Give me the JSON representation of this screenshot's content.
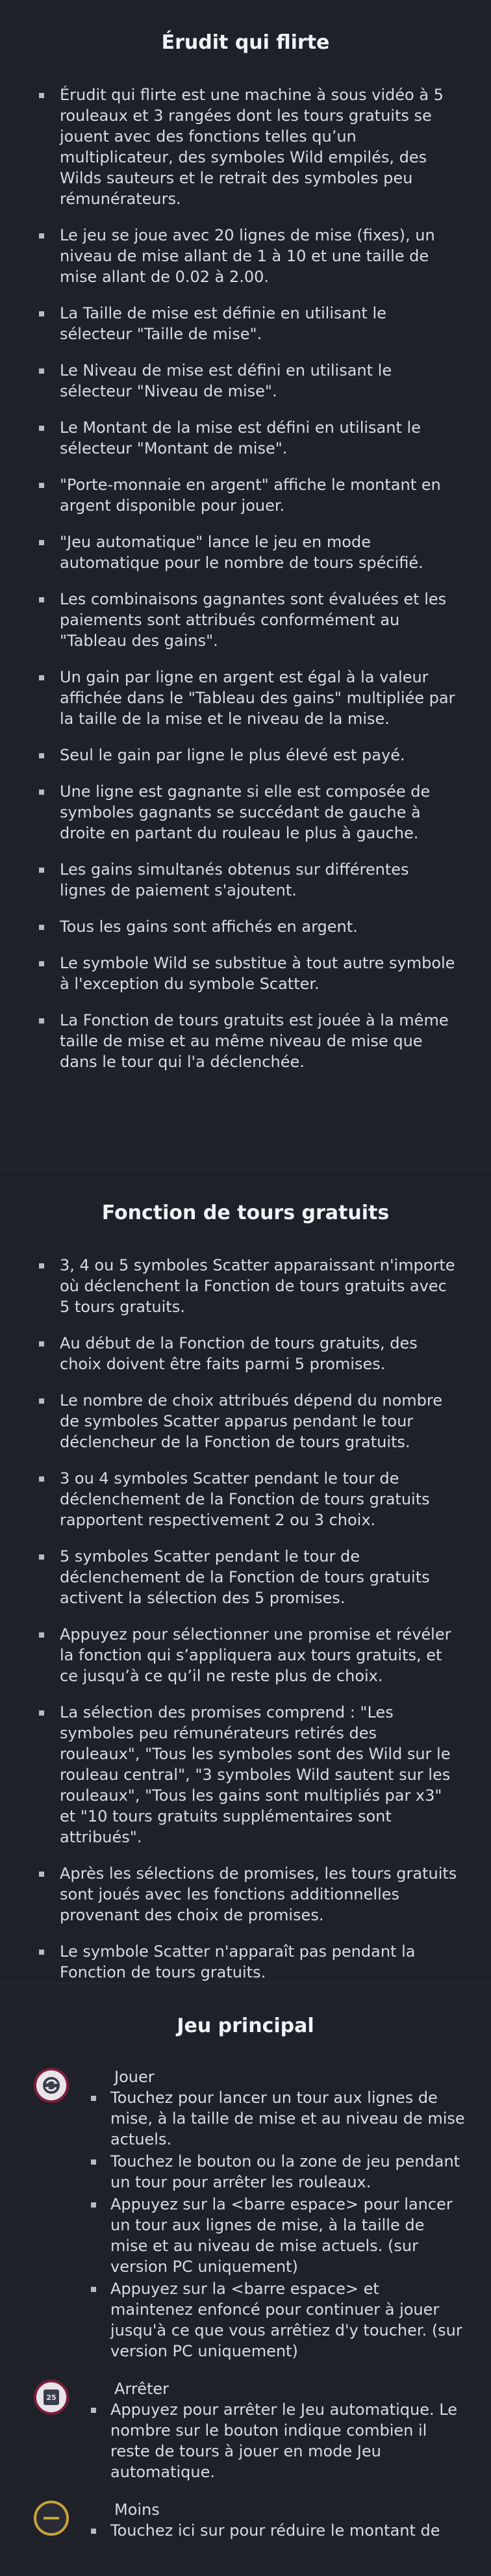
{
  "section1": {
    "title": "Érudit qui flirte",
    "items": [
      "Érudit qui flirte est une machine à sous vidéo à 5 rouleaux et 3 rangées dont les tours gratuits se jouent avec des fonctions telles qu’un multiplicateur, des symboles Wild empilés, des Wilds sauteurs et le retrait des symboles peu rémunérateurs.",
      "Le jeu se joue avec 20 lignes de mise (fixes), un niveau de mise allant de 1 à 10 et une taille de mise allant de 0.02 à 2.00.",
      "La Taille de mise est définie en utilisant le sélecteur \"Taille de mise\".",
      "Le Niveau de mise est défini en utilisant le sélecteur \"Niveau de mise\".",
      "Le Montant de la mise est défini en utilisant le sélecteur \"Montant de mise\".",
      "\"Porte-monnaie en argent\" affiche le montant en argent disponible pour jouer.",
      "\"Jeu automatique\" lance le jeu en mode automatique pour le nombre de tours spécifié.",
      "Les combinaisons gagnantes sont évaluées et les paiements sont attribués conformément au \"Tableau des gains\".",
      "Un gain par ligne en argent est égal à la valeur affichée dans le \"Tableau des gains\" multipliée par la taille de la mise et le niveau de la mise.",
      "Seul le gain par ligne le plus élevé est payé.",
      "Une ligne est gagnante si elle est composée de symboles gagnants se succédant de gauche à droite en partant du rouleau le plus à gauche.",
      "Les gains simultanés obtenus sur différentes lignes de paiement s'ajoutent.",
      "Tous les gains sont affichés en argent.",
      "Le symbole Wild se substitue à tout autre symbole à l'exception du symbole Scatter.",
      "La Fonction de tours gratuits est jouée à la même taille de mise et au même niveau de mise que dans le tour qui l'a déclenchée."
    ]
  },
  "section2": {
    "title": "Fonction de tours gratuits",
    "items": [
      "3, 4 ou 5 symboles Scatter apparaissant n'importe où déclenchent la Fonction de tours gratuits avec 5 tours gratuits.",
      "Au début de la Fonction de tours gratuits, des choix doivent être faits parmi 5 promises.",
      "Le nombre de choix attribués dépend du nombre de symboles Scatter apparus pendant le tour déclencheur de la Fonction de tours gratuits.",
      "3 ou 4 symboles Scatter pendant le tour de déclenchement de la Fonction de tours gratuits rapportent respectivement 2 ou 3 choix.",
      "5 symboles Scatter pendant le tour de déclenchement de la Fonction de tours gratuits activent la sélection des 5 promises.",
      "Appuyez pour sélectionner une promise et révéler la fonction qui s’appliquera aux tours gratuits, et ce jusqu’à ce qu’il ne reste plus de choix.",
      "La sélection des promises comprend : \"Les symboles peu rémunérateurs retirés des rouleaux\", \"Tous les symboles sont des Wild sur le rouleau central\", \"3 symboles Wild sautent sur les rouleaux\", \"Tous les gains sont multipliés par x3\" et \"10 tours gratuits supplémentaires sont attribués\".",
      "Après les sélections de promises, les tours gratuits sont joués avec les fonctions additionnelles provenant des choix de promises.",
      "Le symbole Scatter n'apparaît pas pendant la Fonction de tours gratuits."
    ]
  },
  "section3": {
    "title": "Jeu principal",
    "controls": [
      {
        "name": "Jouer",
        "icon": "spin-icon",
        "items": [
          "Touchez pour lancer un tour aux lignes de mise, à la taille de mise et au niveau de mise actuels.",
          "Touchez le bouton ou la zone de jeu pendant un tour pour arrêter les rouleaux.",
          "Appuyez sur la <barre espace> pour lancer un tour aux lignes de mise, à la taille de mise et au niveau de mise actuels. (sur version PC uniquement)",
          "Appuyez sur la <barre espace> et maintenez enfoncé pour continuer à jouer jusqu'à ce que vous arrêtiez d'y toucher. (sur version PC uniquement)"
        ]
      },
      {
        "name": "Arrêter",
        "icon": "stop-icon",
        "badge": "25",
        "items": [
          "Appuyez pour arrêter le Jeu automatique. Le nombre sur le bouton indique combien il reste de tours à jouer en mode Jeu automatique."
        ]
      },
      {
        "name": "Moins",
        "icon": "minus-icon",
        "items": [
          "Touchez ici sur pour réduire le montant de"
        ]
      }
    ]
  }
}
